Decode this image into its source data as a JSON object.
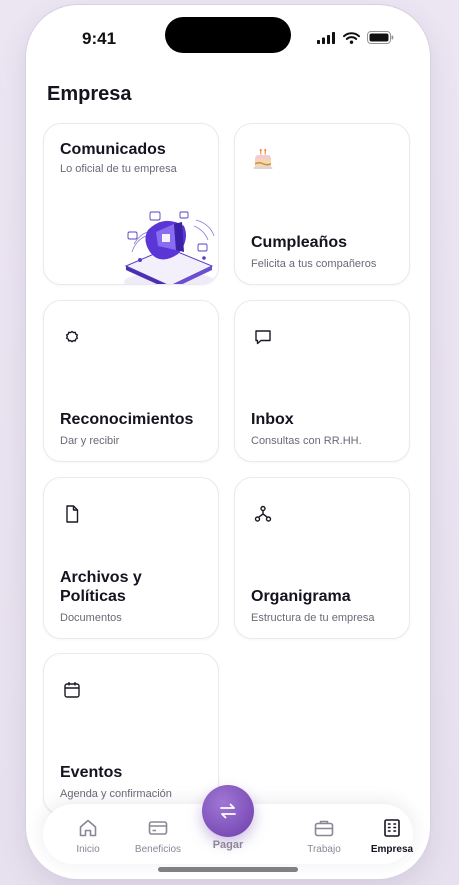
{
  "status_bar": {
    "time": "9:41"
  },
  "page": {
    "title": "Empresa"
  },
  "cards": [
    {
      "title": "Comunicados",
      "subtitle": "Lo oficial de tu empresa",
      "icon": "megaphone-illustration"
    },
    {
      "title": "Cumpleaños",
      "subtitle": "Felicita a tus compañeros",
      "icon": "birthday-cake-icon"
    },
    {
      "title": "Reconocimientos",
      "subtitle": "Dar y recibir",
      "icon": "badge-icon"
    },
    {
      "title": "Inbox",
      "subtitle": "Consultas con RR.HH.",
      "icon": "chat-bubble-icon"
    },
    {
      "title": "Archivos y Políticas",
      "subtitle": "Documentos",
      "icon": "document-icon"
    },
    {
      "title": "Organigrama",
      "subtitle": "Estructura de tu empresa",
      "icon": "org-chart-icon"
    },
    {
      "title": "Eventos",
      "subtitle": "Agenda y confirmación",
      "icon": "calendar-icon"
    }
  ],
  "nav": {
    "items": [
      {
        "label": "Inicio",
        "icon": "home-icon"
      },
      {
        "label": "Beneficios",
        "icon": "card-icon"
      },
      {
        "label": "Pagar",
        "icon": "swap-arrows-icon"
      },
      {
        "label": "Trabajo",
        "icon": "briefcase-icon"
      },
      {
        "label": "Empresa",
        "icon": "building-icon"
      }
    ],
    "active": "Empresa"
  },
  "colors": {
    "accent": "#7c4fb8",
    "title": "#16121f",
    "subtitle": "#6d6876",
    "nav_inactive": "#8b8695"
  }
}
